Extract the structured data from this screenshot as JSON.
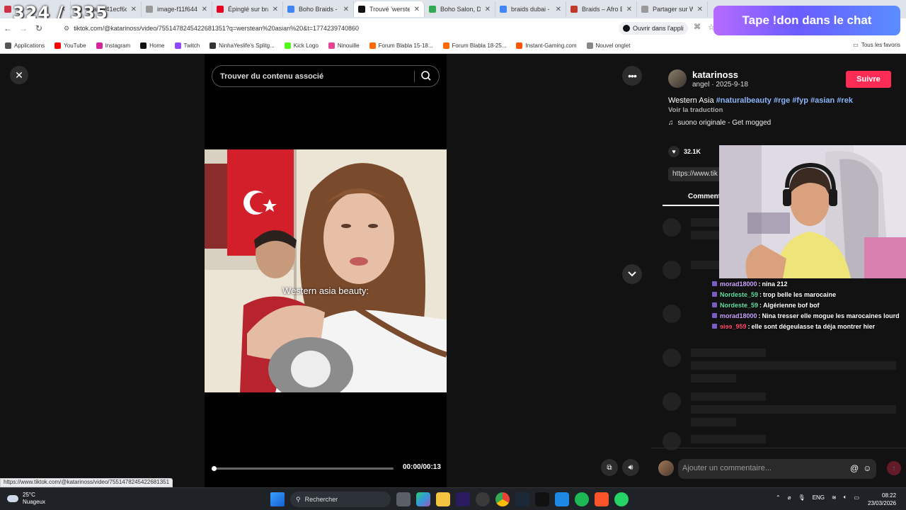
{
  "overlay": {
    "counter": "324 / 335",
    "donate": "Tape !don dans le chat"
  },
  "tabs": [
    {
      "label": "",
      "color": "#cc3344",
      "icon": "globe-icon"
    },
    {
      "label": "image-41ecf6c",
      "color": "#999999",
      "icon": "globe-icon"
    },
    {
      "label": "image-f11f644",
      "color": "#999999",
      "icon": "globe-icon"
    },
    {
      "label": "Épinglé sur bra",
      "color": "#e60023",
      "icon": "pinterest-icon"
    },
    {
      "label": "Boho Braids - 1",
      "color": "#4285f4",
      "icon": "google-icon"
    },
    {
      "label": "Trouvé 'werste",
      "color": "#111111",
      "icon": "tiktok-icon",
      "active": true
    },
    {
      "label": "Boho Salon, Dh",
      "color": "#34a853",
      "icon": "maps-icon"
    },
    {
      "label": "braids dubai -",
      "color": "#4285f4",
      "icon": "google-icon"
    },
    {
      "label": "Braids – Afro B",
      "color": "#c0392b",
      "icon": "globe-icon"
    },
    {
      "label": "Partager sur W",
      "color": "#999999",
      "icon": "globe-icon"
    }
  ],
  "address": {
    "url": "tiktok.com/@katarinoss/video/7551478245422681351?q=werstean%20asian%20&t=1774239740860",
    "open_app": "Ouvrir dans l'appli"
  },
  "bookmarks": [
    {
      "label": "Applications",
      "color": "#555555"
    },
    {
      "label": "YouTube",
      "color": "#ff0000"
    },
    {
      "label": "Instagram",
      "color": "#d6249f"
    },
    {
      "label": "Home",
      "color": "#111111"
    },
    {
      "label": "Twitch",
      "color": "#9146ff"
    },
    {
      "label": "NinhaYeslife's Splitg...",
      "color": "#333333"
    },
    {
      "label": "Kick Logo",
      "color": "#53fc18"
    },
    {
      "label": "Ninouille",
      "color": "#e84393"
    },
    {
      "label": "Forum Blabla 15-18...",
      "color": "#ff6a00"
    },
    {
      "label": "Forum Blabla 18-25...",
      "color": "#ff6a00"
    },
    {
      "label": "Instant-Gaming.com",
      "color": "#ff5400"
    },
    {
      "label": "Nouvel onglet",
      "color": "#888888"
    }
  ],
  "bookmarks_right": "Tous les favoris",
  "video": {
    "search_placeholder": "Trouver du contenu associé",
    "caption": "Western asia beauty:",
    "time": "00:00/00:13",
    "progress_fraction": 0.0
  },
  "post": {
    "username": "katarinoss",
    "meta": "angel · 2025-9-18",
    "follow": "Suivre",
    "desc_text": "Western Asia",
    "tags": [
      "#naturalbeauty",
      "#rge",
      "#fyp",
      "#asian",
      "#rek"
    ],
    "translate": "Voir la traduction",
    "sound": "suono originale - Get mogged",
    "likes": "32.1K",
    "link": "https://www.tik",
    "comments_tab": "Comment",
    "comment_placeholder": "Ajouter un commentaire..."
  },
  "chat": [
    {
      "user": "morad18000",
      "color": "#c9a3ff",
      "msg": "nina 212"
    },
    {
      "user": "Nordeste_59",
      "color": "#5ee0a0",
      "msg": "trop belle les marocaine"
    },
    {
      "user": "Nordeste_59",
      "color": "#5ee0a0",
      "msg": "Algérienne bof bof"
    },
    {
      "user": "morad18000",
      "color": "#c9a3ff",
      "msg": "Nina tresser elle mogue les marocaines lourd"
    },
    {
      "user": "ɘiɘɘ_959",
      "color": "#ff4d6d",
      "msg": "elle sont dégeulasse ta déja montrer hier"
    }
  ],
  "status_url": "https://www.tiktok.com/@katarinoss/video/7551478245422681351",
  "taskbar": {
    "temp": "25°C",
    "weather": "Nuageux",
    "search": "Rechercher",
    "lang": "ENG",
    "time": "08:22",
    "date": "23/03/2026"
  }
}
